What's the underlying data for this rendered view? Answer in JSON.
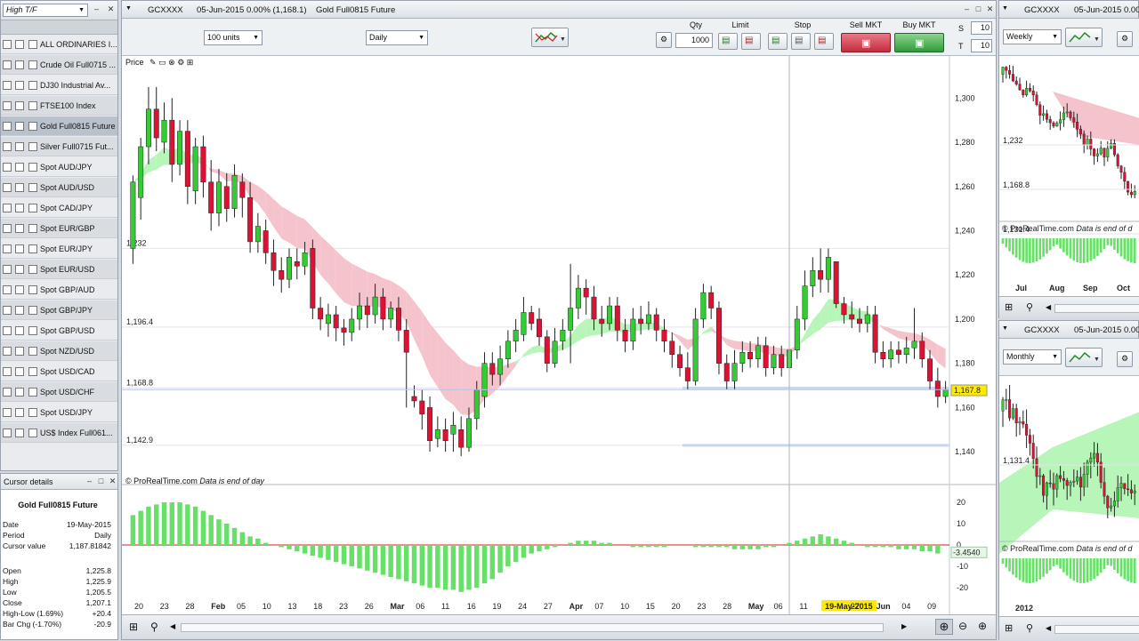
{
  "left": {
    "timeframe": "High T/F",
    "rows": [
      "ALL ORDINARIES I...",
      "Crude Oil Full0715 ...",
      "DJ30 Industrial Av...",
      "FTSE100 Index",
      "Gold Full0815 Future",
      "Silver Full0715 Fut...",
      "Spot AUD/JPY",
      "Spot AUD/USD",
      "Spot CAD/JPY",
      "Spot EUR/GBP",
      "Spot EUR/JPY",
      "Spot EUR/USD",
      "Spot GBP/AUD",
      "Spot GBP/JPY",
      "Spot GBP/USD",
      "Spot NZD/USD",
      "Spot USD/CAD",
      "Spot USD/CHF",
      "Spot USD/JPY",
      "US$ Index Full061..."
    ],
    "cursor_panel": {
      "title": "Cursor details",
      "instrument": "Gold Full0815 Future",
      "info": [
        [
          "Date",
          "19-May-2015"
        ],
        [
          "Period",
          "Daily"
        ],
        [
          "Cursor value",
          "1,187.81842"
        ]
      ],
      "ohlc": [
        [
          "Open",
          "1,225.8"
        ],
        [
          "High",
          "1,225.9"
        ],
        [
          "Low",
          "1,205.5"
        ],
        [
          "Close",
          "1,207.1"
        ],
        [
          "High-Low (1.69%)",
          "+20.4"
        ],
        [
          "Bar Chg (-1.70%)",
          "-20.9"
        ]
      ]
    }
  },
  "main": {
    "symbol": "GCXXXX",
    "header": "05-Jun-2015  0.00% (1,168.1)",
    "name": "Gold Full0815 Future",
    "units": "100 units",
    "period": "Daily",
    "qty_label": "Qty",
    "qty": "1000",
    "limit_label": "Limit",
    "stop_label": "Stop",
    "sell_label": "Sell MKT",
    "buy_label": "Buy MKT",
    "s_label": "S",
    "t_label": "T",
    "s_val": "10",
    "t_val": "10",
    "price_label": "Price",
    "footer_note": "© ProRealTime.com",
    "footer_italic": "Data is end of day",
    "price_ticks": [
      "1,300",
      "1,280",
      "1,260",
      "1,240",
      "1,220",
      "1,200",
      "1,180",
      "1,160",
      "1,140"
    ],
    "level_labels": [
      "1,232",
      "1,196.4",
      "1,168.8",
      "1,142.9"
    ],
    "last_price": "1,167.8",
    "osc_ticks": [
      "20",
      "10",
      "0",
      "-10",
      "-20"
    ],
    "osc_value": "-3.4540",
    "date_labels": [
      "20",
      "23",
      "28",
      "Feb",
      "05",
      "10",
      "13",
      "18",
      "23",
      "26",
      "Mar",
      "06",
      "11",
      "16",
      "19",
      "24",
      "27",
      "Apr",
      "07",
      "10",
      "15",
      "20",
      "23",
      "28",
      "May",
      "06",
      "11",
      "19-May-2015",
      "27",
      "Jun",
      "04",
      "09"
    ]
  },
  "right_top": {
    "symbol": "GCXXXX",
    "header": "05-Jun-2015  0.00",
    "period": "Weekly",
    "levels": [
      "1,232",
      "1,168.8",
      "1,131.4"
    ],
    "note": "© ProRealTime.com",
    "note_italic": "Data is end of d",
    "months": [
      "Jul",
      "Aug",
      "Sep",
      "Oct"
    ]
  },
  "right_bottom": {
    "symbol": "GCXXXX",
    "header": "05-Jun-2015  0.00",
    "period": "Monthly",
    "levels": [
      "1,131.4"
    ],
    "note": "© ProRealTime.com",
    "note_italic": "Data is end of d",
    "years": [
      "2012"
    ]
  },
  "colors": {
    "up": "#33cc33",
    "down": "#dd1133",
    "band_up": "#b8f5b8",
    "band_down": "#f4c3cc",
    "osc": "#66e066"
  },
  "chart_data": {
    "type": "candlestick",
    "title": "Gold Full0815 Future",
    "period": "Daily",
    "ylim": [
      1130,
      1315
    ],
    "osc_ylim": [
      -25,
      25
    ],
    "candles": [
      [
        1232,
        1262,
        1225,
        1265
      ],
      [
        1255,
        1278,
        1245,
        1282
      ],
      [
        1278,
        1295,
        1270,
        1305
      ],
      [
        1295,
        1282,
        1276,
        1305
      ],
      [
        1280,
        1290,
        1275,
        1298
      ],
      [
        1290,
        1270,
        1262,
        1300
      ],
      [
        1270,
        1285,
        1265,
        1290
      ],
      [
        1285,
        1260,
        1252,
        1290
      ],
      [
        1258,
        1278,
        1252,
        1282
      ],
      [
        1278,
        1262,
        1255,
        1283
      ],
      [
        1262,
        1248,
        1240,
        1272
      ],
      [
        1248,
        1262,
        1242,
        1268
      ],
      [
        1260,
        1250,
        1244,
        1266
      ],
      [
        1250,
        1265,
        1246,
        1270
      ],
      [
        1262,
        1255,
        1246,
        1266
      ],
      [
        1255,
        1235,
        1230,
        1262
      ],
      [
        1235,
        1242,
        1230,
        1248
      ],
      [
        1240,
        1230,
        1225,
        1245
      ],
      [
        1230,
        1222,
        1215,
        1236
      ],
      [
        1222,
        1218,
        1212,
        1228
      ],
      [
        1218,
        1228,
        1214,
        1232
      ],
      [
        1226,
        1224,
        1218,
        1232
      ],
      [
        1224,
        1230,
        1220,
        1235
      ],
      [
        1232,
        1205,
        1200,
        1236
      ],
      [
        1205,
        1200,
        1195,
        1210
      ],
      [
        1198,
        1202,
        1192,
        1207
      ],
      [
        1202,
        1196,
        1190,
        1206
      ],
      [
        1196,
        1194,
        1188,
        1200
      ],
      [
        1194,
        1200,
        1190,
        1205
      ],
      [
        1200,
        1206,
        1195,
        1212
      ],
      [
        1206,
        1202,
        1196,
        1210
      ],
      [
        1202,
        1210,
        1198,
        1216
      ],
      [
        1210,
        1200,
        1195,
        1214
      ],
      [
        1200,
        1205,
        1196,
        1208
      ],
      [
        1205,
        1195,
        1190,
        1210
      ],
      [
        1195,
        1185,
        1160,
        1200
      ],
      [
        1165,
        1163,
        1160,
        1170
      ],
      [
        1163,
        1157,
        1150,
        1168
      ],
      [
        1160,
        1145,
        1140,
        1165
      ],
      [
        1146,
        1150,
        1142,
        1156
      ],
      [
        1150,
        1145,
        1140,
        1155
      ],
      [
        1148,
        1152,
        1140,
        1158
      ],
      [
        1150,
        1142,
        1138,
        1156
      ],
      [
        1142,
        1155,
        1140,
        1160
      ],
      [
        1155,
        1168,
        1150,
        1172
      ],
      [
        1165,
        1180,
        1160,
        1185
      ],
      [
        1180,
        1175,
        1170,
        1185
      ],
      [
        1175,
        1182,
        1170,
        1188
      ],
      [
        1182,
        1190,
        1178,
        1195
      ],
      [
        1190,
        1195,
        1185,
        1200
      ],
      [
        1193,
        1203,
        1190,
        1210
      ],
      [
        1203,
        1198,
        1195,
        1206
      ],
      [
        1200,
        1192,
        1188,
        1205
      ],
      [
        1192,
        1180,
        1176,
        1195
      ],
      [
        1180,
        1190,
        1178,
        1196
      ],
      [
        1190,
        1195,
        1186,
        1200
      ],
      [
        1195,
        1205,
        1180,
        1225
      ],
      [
        1205,
        1214,
        1200,
        1220
      ],
      [
        1214,
        1210,
        1202,
        1218
      ],
      [
        1210,
        1200,
        1195,
        1215
      ],
      [
        1200,
        1198,
        1192,
        1206
      ],
      [
        1198,
        1206,
        1195,
        1210
      ],
      [
        1206,
        1195,
        1190,
        1210
      ],
      [
        1195,
        1190,
        1185,
        1200
      ],
      [
        1190,
        1200,
        1186,
        1205
      ],
      [
        1200,
        1198,
        1193,
        1206
      ],
      [
        1198,
        1202,
        1195,
        1208
      ],
      [
        1202,
        1195,
        1190,
        1205
      ],
      [
        1195,
        1190,
        1185,
        1200
      ],
      [
        1190,
        1184,
        1178,
        1194
      ],
      [
        1184,
        1178,
        1174,
        1188
      ],
      [
        1178,
        1172,
        1168,
        1185
      ],
      [
        1172,
        1200,
        1170,
        1205
      ],
      [
        1200,
        1212,
        1196,
        1216
      ],
      [
        1212,
        1205,
        1200,
        1215
      ],
      [
        1205,
        1180,
        1175,
        1208
      ],
      [
        1180,
        1172,
        1168,
        1184
      ],
      [
        1172,
        1180,
        1168,
        1186
      ],
      [
        1180,
        1185,
        1176,
        1190
      ],
      [
        1185,
        1182,
        1178,
        1190
      ],
      [
        1182,
        1188,
        1178,
        1192
      ],
      [
        1188,
        1178,
        1174,
        1192
      ],
      [
        1178,
        1184,
        1175,
        1188
      ],
      [
        1184,
        1178,
        1174,
        1188
      ],
      [
        1178,
        1186,
        1175,
        1190
      ],
      [
        1186,
        1200,
        1182,
        1206
      ],
      [
        1200,
        1215,
        1195,
        1222
      ],
      [
        1215,
        1222,
        1210,
        1228
      ],
      [
        1222,
        1218,
        1212,
        1232
      ],
      [
        1218,
        1228,
        1212,
        1232
      ],
      [
        1226,
        1207,
        1205,
        1226
      ],
      [
        1207,
        1202,
        1198,
        1210
      ],
      [
        1202,
        1200,
        1196,
        1208
      ],
      [
        1200,
        1198,
        1194,
        1205
      ],
      [
        1198,
        1202,
        1194,
        1206
      ],
      [
        1202,
        1185,
        1180,
        1206
      ],
      [
        1185,
        1182,
        1178,
        1190
      ],
      [
        1182,
        1186,
        1178,
        1190
      ],
      [
        1186,
        1184,
        1180,
        1190
      ],
      [
        1184,
        1187,
        1180,
        1192
      ],
      [
        1187,
        1190,
        1182,
        1205
      ],
      [
        1190,
        1182,
        1178,
        1194
      ],
      [
        1182,
        1172,
        1168,
        1186
      ],
      [
        1172,
        1165,
        1160,
        1178
      ],
      [
        1165,
        1168,
        1162,
        1172
      ]
    ],
    "oscillator": [
      14,
      16,
      18,
      19,
      20,
      20,
      20,
      19,
      18,
      16,
      14,
      12,
      10,
      8,
      6,
      4,
      3,
      1,
      0,
      -1,
      -2,
      -3,
      -4,
      -5,
      -6,
      -7,
      -8,
      -9,
      -10,
      -11,
      -12,
      -13,
      -14,
      -15,
      -16,
      -17,
      -18,
      -19,
      -20,
      -20,
      -21,
      -21,
      -22,
      -21,
      -20,
      -18,
      -16,
      -13,
      -10,
      -8,
      -6,
      -4,
      -3,
      -2,
      -1,
      0,
      1,
      2,
      2,
      2,
      1,
      1,
      0,
      0,
      -1,
      -1,
      -1,
      -1,
      -1,
      0,
      0,
      0,
      -1,
      -1,
      -1,
      -1,
      -1,
      -2,
      -2,
      -2,
      -2,
      -1,
      -1,
      0,
      1,
      2,
      3,
      4,
      5,
      4,
      3,
      2,
      1,
      0,
      -1,
      -1,
      -1,
      -1,
      -2,
      -2,
      -2,
      -3,
      -3,
      -4
    ]
  }
}
